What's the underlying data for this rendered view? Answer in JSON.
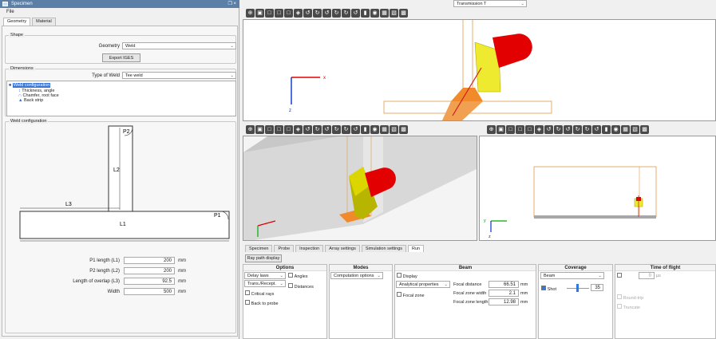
{
  "window": {
    "title": "Specimen",
    "controls": "❐ ×"
  },
  "menu": {
    "file": "File"
  },
  "tabs": [
    {
      "label": "Geometry"
    },
    {
      "label": "Material"
    }
  ],
  "shape": {
    "legend": "Shape",
    "geometry_label": "Geometry",
    "geometry_value": "Weld",
    "export_button": "Export IGES"
  },
  "dimensions": {
    "legend": "Dimensions",
    "weld_type_label": "Type of Weld",
    "weld_type_value": "Tee weld",
    "tree": [
      {
        "label": "Weld configuration",
        "selected": true
      },
      {
        "label": "Thickness, angle"
      },
      {
        "label": "Chamfer, root face"
      },
      {
        "label": "Back strip"
      }
    ]
  },
  "weld_config": {
    "legend": "Weld configuration",
    "labels": {
      "p2": "P2",
      "p1": "P1",
      "l1": "L1",
      "l2": "L2",
      "l3": "L3"
    },
    "fields": [
      {
        "label": "P1 length (L1)",
        "value": "200",
        "unit": "mm"
      },
      {
        "label": "P2 length (L2)",
        "value": "200",
        "unit": "mm"
      },
      {
        "label": "Length of overlap (L3)",
        "value": "92.5",
        "unit": "mm"
      },
      {
        "label": "Width",
        "value": "500",
        "unit": "mm"
      }
    ]
  },
  "viewport_axes": {
    "x": "x",
    "z": "z",
    "y": "y"
  },
  "bottom_tabs": [
    {
      "label": "Specimen"
    },
    {
      "label": "Probe"
    },
    {
      "label": "Inspection"
    },
    {
      "label": "Array settings"
    },
    {
      "label": "Simulation settings"
    },
    {
      "label": "Run",
      "active": true
    }
  ],
  "ray_path_button": "Ray path display",
  "options": {
    "title": "Options",
    "delay_laws": "Delay laws",
    "trans_recept": "Trans./Recept.",
    "angles": "Angles",
    "distances": "Distances",
    "critical_rays": "Critical rays",
    "back_to_probe": "Back to probe"
  },
  "modes": {
    "title": "Modes",
    "computation_options": "Computation options"
  },
  "beam": {
    "title": "Beam",
    "display": "Display",
    "analytical": "Analytical properties",
    "focal_zone": "Focal zone",
    "mode": "Transmission T",
    "fields": [
      {
        "label": "Focal distance",
        "value": "66.51",
        "unit": "mm"
      },
      {
        "label": "Focal zone width",
        "value": "2.1",
        "unit": "mm"
      },
      {
        "label": "Focal zone length",
        "value": "12.98",
        "unit": "mm"
      }
    ]
  },
  "coverage": {
    "title": "Coverage",
    "mode": "Beam",
    "shot": "Shot",
    "shot_value": "35"
  },
  "tof": {
    "title": "Time of flight",
    "value": "0",
    "unit": "µs",
    "roundtrip": "Round-trip",
    "truncate": "Truncate"
  },
  "colors": {
    "weld": "#f08a2a",
    "probe": "#e8e000",
    "wedge": "#e00000",
    "titlebar": "#5b7fa6"
  }
}
